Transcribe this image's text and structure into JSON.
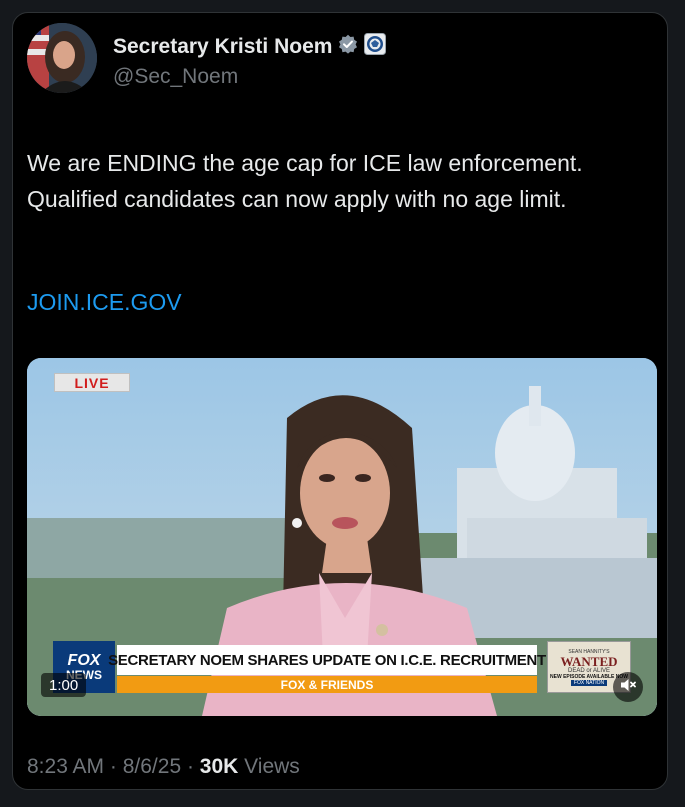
{
  "author": {
    "name": "Secretary Kristi Noem",
    "handle": "@Sec_Noem",
    "badges": [
      "verified-badge-icon",
      "dhs-seal-icon"
    ]
  },
  "tweet": {
    "text": "We are ENDING the age cap for ICE law enforcement. Qualified candidates can now apply with no age limit.",
    "link": "JOIN.ICE.GOV"
  },
  "video": {
    "live_label": "LIVE",
    "network_logo_line1": "FOX",
    "network_logo_line2": "NEWS",
    "headline": "SECRETARY NOEM SHARES UPDATE ON I.C.E. RECRUITMENT",
    "show_name": "FOX & FRIENDS",
    "promo": {
      "line1": "SEAN HANNITY'S",
      "line2": "WANTED",
      "line3": "DEAD or ALIVE",
      "line4": "NEW EPISODE AVAILABLE NOW",
      "line5": "FOX NATION"
    },
    "duration": "1:00",
    "icons": [
      "volume-muted-icon"
    ]
  },
  "meta": {
    "time": "8:23 AM",
    "date": "8/6/25",
    "views_count": "30K",
    "views_label": "Views"
  },
  "colors": {
    "link": "#1d9bf0",
    "verified": "#8b98a5",
    "fox_orange": "#f29b12",
    "fox_blue": "#0a3a7a",
    "live_red": "#d11d1d"
  }
}
